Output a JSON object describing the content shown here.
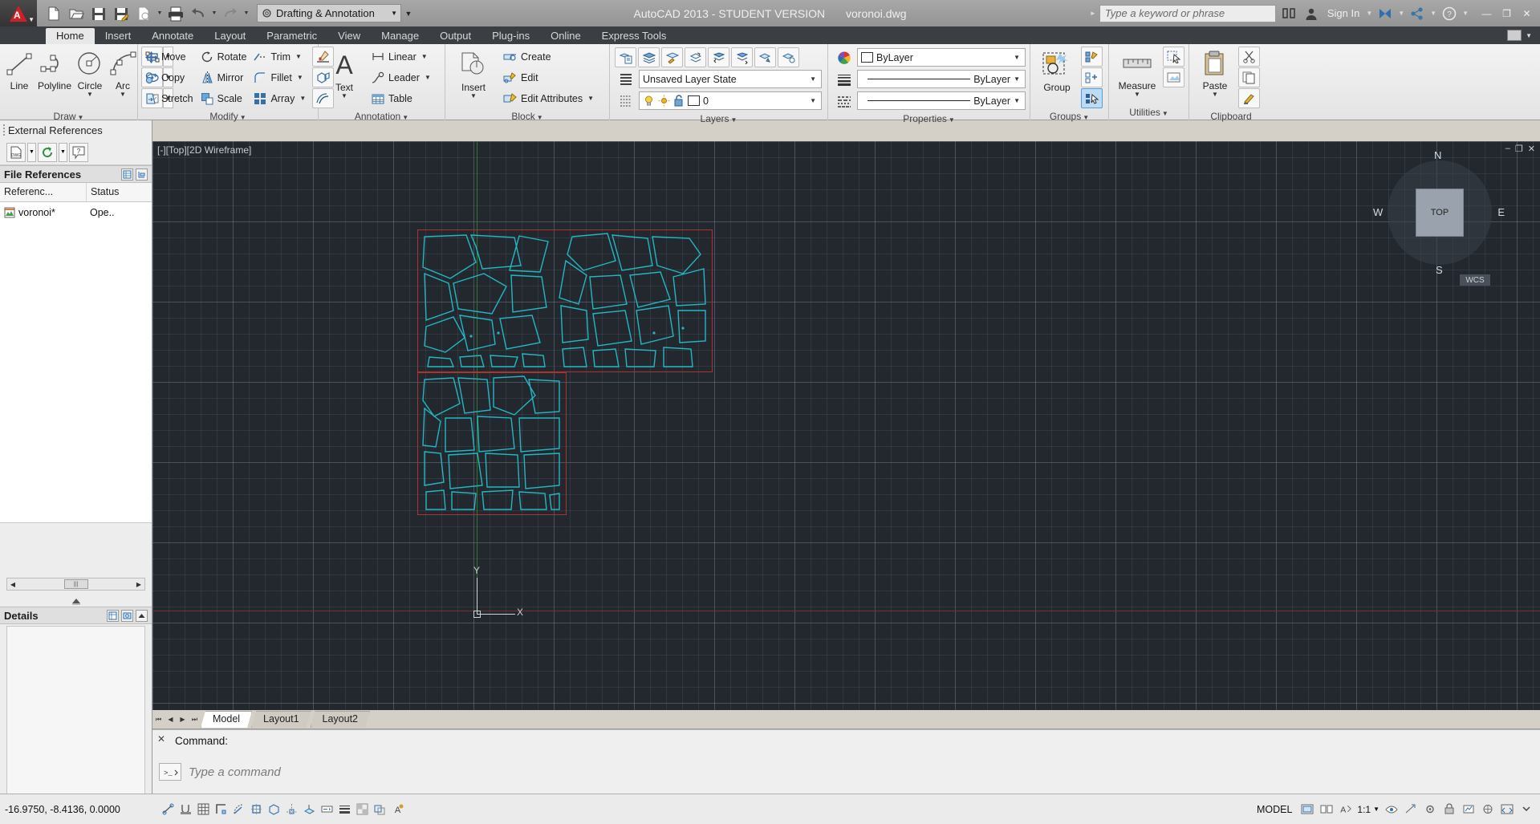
{
  "titlebar": {
    "app_menu": "A",
    "quick_access": [
      {
        "name": "new-file-icon",
        "label": "New"
      },
      {
        "name": "open-file-icon",
        "label": "Open"
      },
      {
        "name": "save-icon",
        "label": "Save"
      },
      {
        "name": "save-as-icon",
        "label": "Save As"
      },
      {
        "name": "plot-preview-icon",
        "label": "Plot Preview"
      },
      {
        "name": "print-icon",
        "label": "Plot"
      },
      {
        "name": "undo-icon",
        "label": "Undo"
      },
      {
        "name": "redo-icon",
        "label": "Redo"
      }
    ],
    "workspace": "Drafting & Annotation",
    "app_title": "AutoCAD 2013 - STUDENT VERSION",
    "file_name": "voronoi.dwg",
    "search_placeholder": "Type a keyword or phrase",
    "sign_in": "Sign In",
    "window_buttons": {
      "minimize": "—",
      "maximize": "❐",
      "close": "✕"
    }
  },
  "ribbon_tabs": [
    {
      "label": "Home",
      "active": true
    },
    {
      "label": "Insert",
      "active": false
    },
    {
      "label": "Annotate",
      "active": false
    },
    {
      "label": "Layout",
      "active": false
    },
    {
      "label": "Parametric",
      "active": false
    },
    {
      "label": "View",
      "active": false
    },
    {
      "label": "Manage",
      "active": false
    },
    {
      "label": "Output",
      "active": false
    },
    {
      "label": "Plug-ins",
      "active": false
    },
    {
      "label": "Online",
      "active": false
    },
    {
      "label": "Express Tools",
      "active": false
    }
  ],
  "panels": {
    "draw": {
      "title": "Draw",
      "big": [
        {
          "label": "Line",
          "icon": "line-icon",
          "dropdown": false
        },
        {
          "label": "Polyline",
          "icon": "polyline-icon",
          "dropdown": false
        },
        {
          "label": "Circle",
          "icon": "circle-icon",
          "dropdown": true
        },
        {
          "label": "Arc",
          "icon": "arc-icon",
          "dropdown": true
        }
      ],
      "small_icons": [
        "rectangle-icon",
        "ellipse-icon",
        "hatch-icon"
      ]
    },
    "modify": {
      "title": "Modify",
      "col1": [
        {
          "label": "Move",
          "icon": "move-icon"
        },
        {
          "label": "Copy",
          "icon": "copy-icon"
        },
        {
          "label": "Stretch",
          "icon": "stretch-icon"
        }
      ],
      "col2": [
        {
          "label": "Rotate",
          "icon": "rotate-icon"
        },
        {
          "label": "Mirror",
          "icon": "mirror-icon"
        },
        {
          "label": "Scale",
          "icon": "scale-icon"
        }
      ],
      "col3": [
        {
          "label": "Trim",
          "icon": "trim-icon",
          "dropdown": true
        },
        {
          "label": "Fillet",
          "icon": "fillet-icon",
          "dropdown": true
        },
        {
          "label": "Array",
          "icon": "array-icon",
          "dropdown": true
        }
      ],
      "col4_icons": [
        "erase-icon",
        "explode-icon",
        "offset-icon"
      ]
    },
    "annotation": {
      "title": "Annotation",
      "big": {
        "label": "Text",
        "icon": "text-icon",
        "dropdown": true
      },
      "items": [
        {
          "label": "Linear",
          "icon": "linear-dimension-icon",
          "dropdown": true
        },
        {
          "label": "Leader",
          "icon": "leader-icon",
          "dropdown": true
        },
        {
          "label": "Table",
          "icon": "table-icon",
          "dropdown": false
        }
      ]
    },
    "block": {
      "title": "Block",
      "big": {
        "label": "Insert",
        "icon": "insert-block-icon",
        "dropdown": true
      },
      "items": [
        {
          "label": "Create",
          "icon": "create-block-icon"
        },
        {
          "label": "Edit",
          "icon": "edit-block-icon"
        },
        {
          "label": "Edit Attributes",
          "icon": "edit-attributes-icon",
          "dropdown": true
        }
      ]
    },
    "layers": {
      "title": "Layers",
      "tool_icons": [
        "layer-properties-icon",
        "layer-manager-icon",
        "layer-match-icon",
        "layer-previous-icon",
        "layer-isolate-icon",
        "layer-unisolate-icon",
        "layer-freeze-icon",
        "layer-off-icon"
      ],
      "layer_state": "Unsaved Layer State",
      "current_layer": "0",
      "layer_state_icons": [
        "lightbulb-icon",
        "sun-icon",
        "unlock-icon"
      ]
    },
    "properties": {
      "title": "Properties",
      "color": "ByLayer",
      "linetype": "ByLayer",
      "lineweight": "ByLayer",
      "icons": [
        "color-wheel-icon",
        "lineweight-icon",
        "linetype-icon"
      ]
    },
    "groups": {
      "title": "Groups",
      "big": {
        "label": "Group",
        "icon": "group-icon"
      },
      "icons": [
        "group-edit-icon",
        "ungroup-icon",
        "group-selection-icon"
      ]
    },
    "utilities": {
      "title": "Utilities",
      "big": {
        "label": "Measure",
        "icon": "measure-icon",
        "dropdown": true
      },
      "icons": [
        "quick-select-icon",
        "id-point-icon"
      ]
    },
    "clipboard": {
      "title": "Clipboard",
      "big": {
        "label": "Paste",
        "icon": "paste-icon",
        "dropdown": true
      },
      "icons": [
        "copy-clip-icon",
        "cut-clip-icon",
        "paste-special-icon",
        "match-properties-icon"
      ]
    }
  },
  "xref_palette": {
    "title": "External References",
    "toolbar_icons": [
      "attach-dwg-icon",
      "refresh-icon",
      "help-icon"
    ],
    "file_references": {
      "header": "File References",
      "columns": [
        "Referenc...",
        "Status"
      ],
      "rows": [
        {
          "name": "voronoi*",
          "status": "Ope..",
          "icon": "dwg-file-icon"
        }
      ]
    },
    "details": {
      "header": "Details"
    },
    "scroll_thumb": "|||"
  },
  "canvas": {
    "viewport_label": "[-][Top][2D Wireframe]",
    "viewcube": {
      "face": "TOP",
      "n": "N",
      "s": "S",
      "e": "E",
      "w": "W"
    },
    "wcs": "WCS",
    "ucs": {
      "x": "X",
      "y": "Y"
    },
    "colors": {
      "background": "#23282f",
      "entity": "#23b7c4",
      "boundary": "#aa3333",
      "x_axis": "#7a2f2f",
      "y_axis": "#2f7a2f"
    },
    "window_buttons": {
      "minimize": "–",
      "restore": "❐",
      "close": "✕"
    }
  },
  "model_tabs": [
    {
      "label": "Model",
      "active": true
    },
    {
      "label": "Layout1",
      "active": false
    },
    {
      "label": "Layout2",
      "active": false
    }
  ],
  "command_line": {
    "history": "Command:",
    "placeholder": "Type a command",
    "prompt_icon": "command-prompt-icon",
    "close_icon": "close-icon"
  },
  "status_bar": {
    "coordinates": "-16.9750, -8.4136, 0.0000",
    "left_icons": [
      "infer-constraints-icon",
      "snap-mode-icon",
      "grid-display-icon",
      "ortho-mode-icon",
      "polar-tracking-icon",
      "object-snap-icon",
      "3d-object-snap-icon",
      "object-snap-tracking-icon",
      "dynamic-ucs-icon",
      "dynamic-input-icon",
      "lineweight-icon",
      "transparency-icon",
      "selection-cycling-icon",
      "annotation-monitor-icon"
    ],
    "space": "MODEL",
    "scale": "1:1",
    "annotation_scale_icon": "annotation-scale-icon",
    "right_icons": [
      "layout-model-icon",
      "quick-view-icon",
      "annotation-visibility-icon",
      "workspace-switch-icon",
      "hardware-accel-icon",
      "isolate-objects-icon",
      "clean-screen-icon"
    ]
  }
}
